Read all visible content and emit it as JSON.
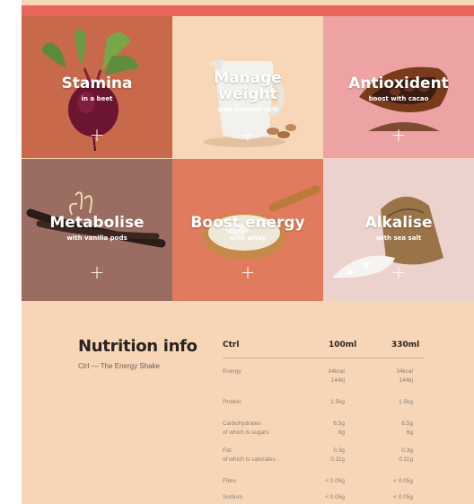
{
  "colors": {
    "top_bar": "#e8655a",
    "stamina": "#c7694a",
    "manage_weight": "#f7d7b8",
    "antioxident": "#eda2a4",
    "metabolise": "#9b6d62",
    "boost_energy": "#e17b5d",
    "alkalise": "#ecd2cc",
    "nutrition_bg": "#f6d6b6"
  },
  "tiles": [
    {
      "title": "Stamina",
      "subtitle": "in a beet",
      "plus": "+",
      "icon": "beet-icon"
    },
    {
      "title_lines": [
        "Manage",
        "weight"
      ],
      "subtitle": "with almond milk",
      "plus": "+",
      "icon": "milk-jug-icon"
    },
    {
      "title": "Antioxident",
      "subtitle": "boost with cacao",
      "plus": "+",
      "icon": "cacao-pod-icon"
    },
    {
      "title": "Metabolise",
      "subtitle": "with vanilla pods",
      "plus": "+",
      "icon": "vanilla-pod-icon"
    },
    {
      "title": "Boost energy",
      "subtitle": "with whey",
      "plus": "+",
      "icon": "wooden-spoon-icon"
    },
    {
      "title": "Alkalise",
      "subtitle": "with sea salt",
      "plus": "+",
      "icon": "salt-sack-icon"
    }
  ],
  "nutrition": {
    "title": "Nutrition info",
    "subtitle": "Ctrl — The Energy Shake",
    "headers": [
      "Ctrl",
      "100ml",
      "330ml"
    ],
    "rows": [
      {
        "label": "Energy",
        "sub_label": "",
        "v100": "34kcal",
        "v100b": "144kj",
        "v330": "34kcal",
        "v330b": "144kj"
      },
      {
        "label": "Protein",
        "sub_label": "",
        "v100": "1.5kg",
        "v100b": "",
        "v330": "1.5kg",
        "v330b": ""
      },
      {
        "label": "Carbohydrates",
        "sub_label": "of which is sugars",
        "v100": "6.5g",
        "v100b": "6g",
        "v330": "6.5g",
        "v330b": "6g"
      },
      {
        "label": "Fat",
        "sub_label": "of which is saturates",
        "v100": "0.3g",
        "v100b": "0.11g",
        "v330": "0.3g",
        "v330b": "0.11g"
      },
      {
        "label": "Fibre",
        "sub_label": "",
        "v100": "< 0.05g",
        "v100b": "",
        "v330": "< 0.05g",
        "v330b": ""
      },
      {
        "label": "Sodium",
        "sub_label": "",
        "v100": "< 0.05g",
        "v100b": "",
        "v330": "< 0.05g",
        "v330b": ""
      }
    ]
  }
}
